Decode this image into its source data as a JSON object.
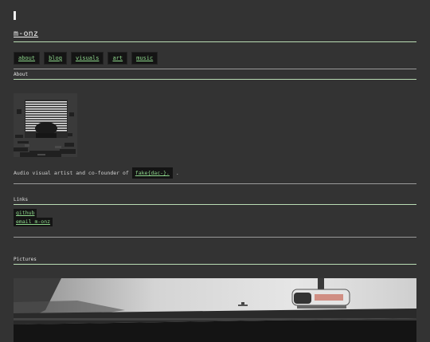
{
  "header": {
    "site_title": "m-onz"
  },
  "nav": {
    "items": [
      {
        "label": "about"
      },
      {
        "label": "blog"
      },
      {
        "label": "visuals"
      },
      {
        "label": "art"
      },
      {
        "label": "music"
      }
    ]
  },
  "about": {
    "title": "About",
    "bio_text": "Audio visual artist and co-founder of",
    "bio_link": "fake{dac-}.",
    "bio_suffix": "."
  },
  "links": {
    "title": "Links",
    "items": [
      {
        "label": "github"
      },
      {
        "label": "email m-onz"
      }
    ]
  },
  "pictures": {
    "title": "Pictures"
  }
}
